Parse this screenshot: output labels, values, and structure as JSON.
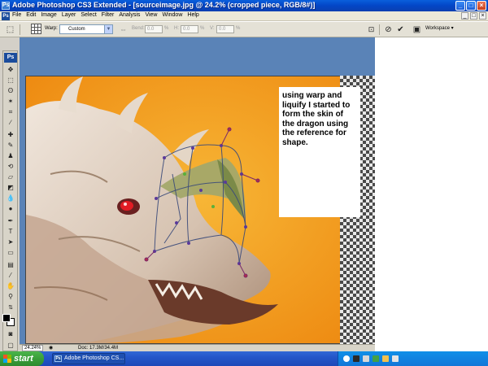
{
  "window": {
    "title": "Adobe Photoshop CS3 Extended - [sourceimage.jpg @ 24.2% (cropped piece, RGB/8#)]",
    "app_icon_label": "Ps",
    "controls": {
      "minimize": "_",
      "maximize": "□",
      "close": "×"
    }
  },
  "menubar": {
    "ps_label": "Ps",
    "items": [
      "File",
      "Edit",
      "Image",
      "Layer",
      "Select",
      "Filter",
      "Analysis",
      "View",
      "Window",
      "Help"
    ],
    "doc_controls": [
      "_",
      "□",
      "×"
    ]
  },
  "options": {
    "warp_label": "Warp:",
    "warp_value": "Custom",
    "bend_label": "Bend:",
    "bend_value": "0.0",
    "h_label": "H:",
    "h_value": "0.0",
    "v_label": "V:",
    "v_value": "0.0",
    "percent": "%",
    "workspace_label": "Workspace ▾"
  },
  "toolbox": {
    "logo": "Ps"
  },
  "note": {
    "text": "using warp and liquify I started to form the skin of the dragon using the reference for shape."
  },
  "statusbar": {
    "zoom": "24.24%",
    "doc": "Doc: 17.3M/34.4M"
  },
  "taskbar": {
    "start_label": "start",
    "task_ps_label": "Adobe Photoshop CS..."
  },
  "colors": {
    "canvas_orange": "#f0a020",
    "doc_area_blue": "#5a83b7",
    "xp_blue": "#2456c9",
    "start_green": "#3a9e3a"
  }
}
